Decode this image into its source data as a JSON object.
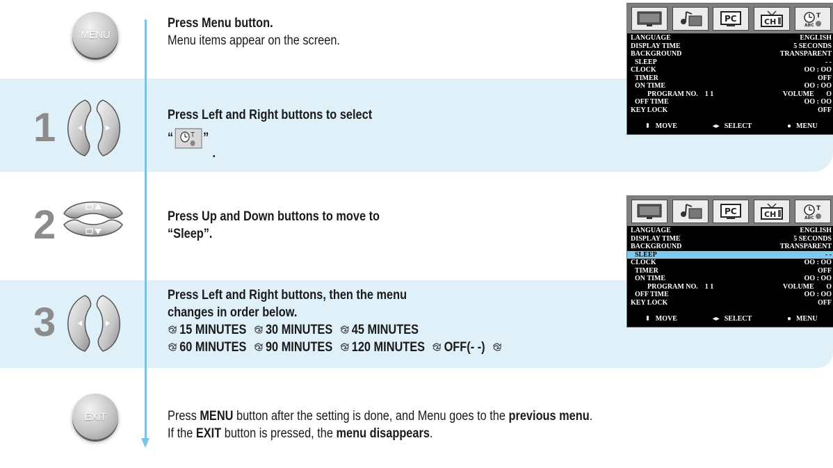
{
  "steps": {
    "menu": {
      "button_label": "MENU",
      "line1": "Press Menu button.",
      "line2": "Menu items appear on the screen."
    },
    "s1": {
      "number": "1",
      "line1": "Press Left and Right buttons to select",
      "quote_open": "“",
      "quote_close": "”",
      "period": "."
    },
    "s2": {
      "number": "2",
      "line1": "Press Up and Down buttons to move to",
      "line2": "“Sleep”."
    },
    "s3": {
      "number": "3",
      "line1": "Press Left and Right buttons, then the menu",
      "line2": "changes in order below.",
      "sequence_row1": [
        "15 MINUTES",
        "30 MINUTES",
        "45 MINUTES"
      ],
      "sequence_row2": [
        "60 MINUTES",
        "90 MINUTES",
        "120 MINUTES",
        "OFF(- -)"
      ]
    },
    "exit": {
      "button_label": "EXIT",
      "l1_a": "Press ",
      "l1_b": "MENU",
      "l1_c": " button after the setting is done, and Menu goes to the ",
      "l1_d": "previous menu",
      "l1_e": ".",
      "l2_a": "If the ",
      "l2_b": "EXIT",
      "l2_c": " button is pressed, the ",
      "l2_d": "menu disappears",
      "l2_e": "."
    }
  },
  "osd": {
    "tabs": [
      "tv-screen-icon",
      "music-picture-icon",
      "pc-icon",
      "channel-icon",
      "clock-timer-icon"
    ],
    "tab_pc_text": "PC",
    "tab_ch_text": "CH",
    "rows": [
      {
        "label": "LANGUAGE",
        "value": "ENGLISH"
      },
      {
        "label": "DISPLAY TIME",
        "value": "5 SECONDS"
      },
      {
        "label": "BACKGROUND",
        "value": "TRANSPARENT"
      },
      {
        "label": "SLEEP",
        "value": "- -"
      },
      {
        "label": "CLOCK",
        "value": "OO : OO"
      },
      {
        "label": "TIMER",
        "value": "OFF"
      },
      {
        "label": "ON TIME",
        "value": "OO : OO"
      },
      {
        "label": "PROGRAM NO.    1 1",
        "value": "VOLUME       O"
      },
      {
        "label": "OFF TIME",
        "value": "OO : OO"
      },
      {
        "label": "KEY LOCK",
        "value": "OFF"
      }
    ],
    "footer": {
      "move": "MOVE",
      "select": "SELECT",
      "menu": "MENU"
    },
    "highlight_color": "#7ecaec"
  },
  "colors": {
    "band": "#dff0f9",
    "flow_line": "#7bc3e6",
    "step_number": "#8c8c8c"
  }
}
